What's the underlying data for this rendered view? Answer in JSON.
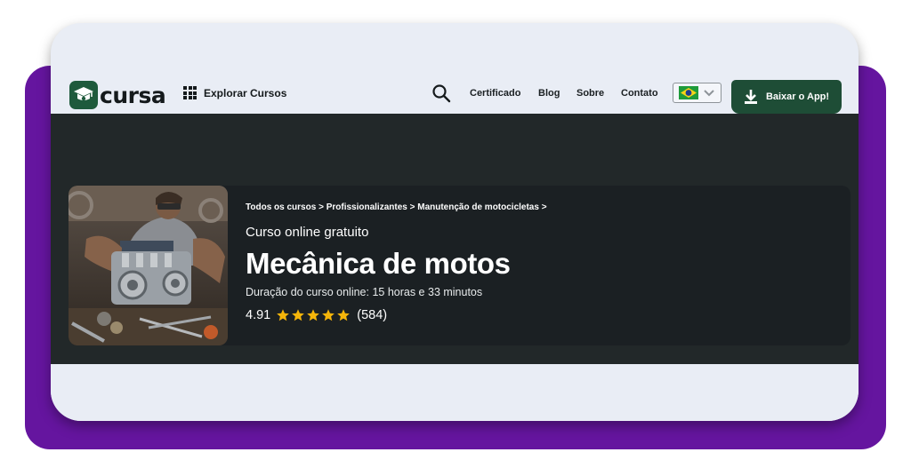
{
  "brand": {
    "logo_text": "cursa",
    "accent": "#1e5a3c",
    "backdrop": "#65159f"
  },
  "header": {
    "explore_label": "Explorar Cursos",
    "search_icon": "search-icon",
    "nav": [
      "Certificado",
      "Blog",
      "Sobre",
      "Contato"
    ],
    "language": {
      "selected": "Brasil",
      "flag_icon": "brazil-flag-icon"
    },
    "app_button_label": "Baixar o App!",
    "app_button_color": "#1e4d36"
  },
  "course": {
    "breadcrumb": [
      "Todos os cursos",
      "Profissionalizantes",
      "Manutenção de motocicletas"
    ],
    "separator": ">",
    "free_label": "Curso online gratuito",
    "title": "Mecânica de motos",
    "duration": "Duração do curso online: 15 horas e 33 minutos",
    "rating": "4.91",
    "rating_value": 4.91,
    "stars_max": 5,
    "reviews": "(584)",
    "star_color": "#f5b50a"
  }
}
